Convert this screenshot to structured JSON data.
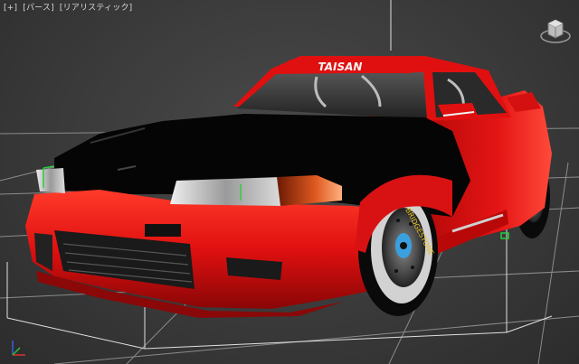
{
  "viewport": {
    "label_parts": [
      "[+]",
      "[パース]",
      "[リアリスティック]"
    ]
  },
  "car": {
    "windshield_banner": "TAISAN",
    "tire_text": "BRIDGESTONE"
  },
  "colors": {
    "body_red": "#e01010",
    "hood_black": "#050505",
    "background": "#3a3a3a",
    "grid_line": "#b0b0b0",
    "selection_box": "#d8d8d8"
  },
  "icons": {
    "viewcube": "viewcube-icon",
    "axis": "axis-tripod-icon"
  }
}
